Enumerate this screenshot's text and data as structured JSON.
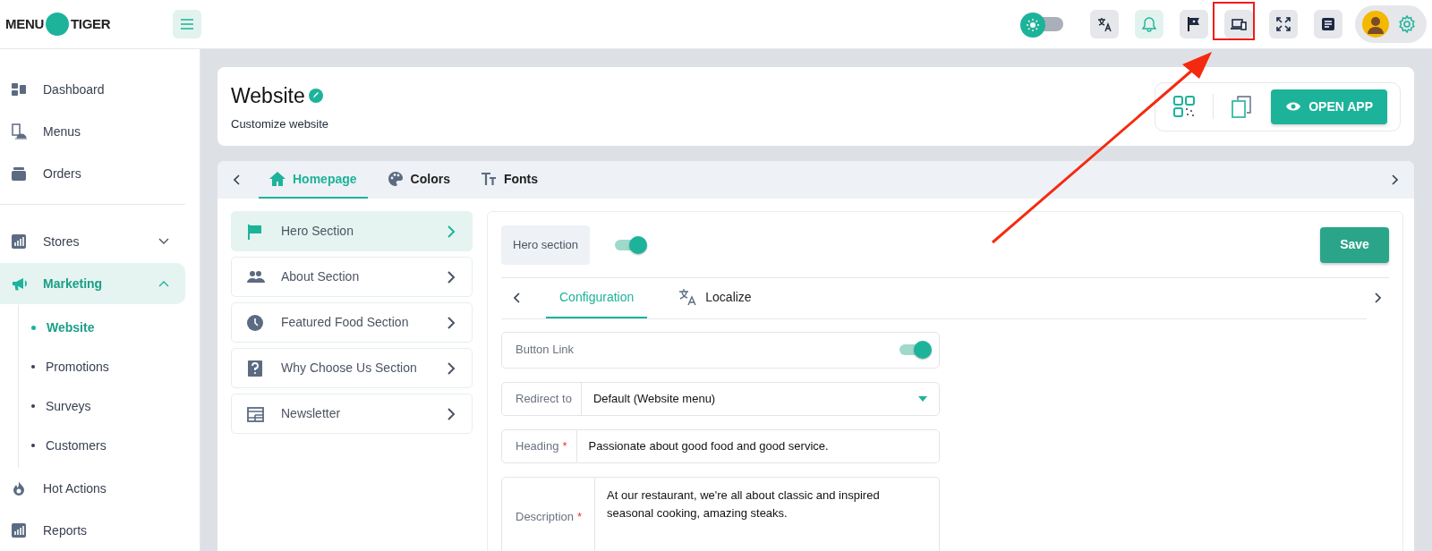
{
  "logo": {
    "left": "MENU",
    "right": "TIGER"
  },
  "topbar": {
    "dark_mode": false
  },
  "sidebar": {
    "groups": [
      {
        "items": [
          {
            "label": "Dashboard"
          },
          {
            "label": "Menus"
          },
          {
            "label": "Orders"
          }
        ]
      },
      {
        "items": [
          {
            "label": "Stores",
            "selected": false,
            "expanded": false
          },
          {
            "label": "Marketing",
            "selected": true,
            "expanded": true,
            "children": [
              {
                "label": "Website",
                "selected": true
              },
              {
                "label": "Promotions",
                "selected": false
              },
              {
                "label": "Surveys",
                "selected": false
              },
              {
                "label": "Customers",
                "selected": false
              }
            ]
          },
          {
            "label": "Hot Actions",
            "selected": false
          },
          {
            "label": "Reports",
            "selected": false
          }
        ]
      }
    ]
  },
  "page_header": {
    "title": "Website",
    "subtitle": "Customize website",
    "open_app_button": "OPEN APP"
  },
  "tabs": [
    {
      "label": "Homepage",
      "selected": true
    },
    {
      "label": "Colors",
      "selected": false
    },
    {
      "label": "Fonts",
      "selected": false
    }
  ],
  "sections": [
    {
      "label": "Hero Section",
      "selected": true
    },
    {
      "label": "About Section",
      "selected": false
    },
    {
      "label": "Featured Food Section",
      "selected": false
    },
    {
      "label": "Why Choose Us Section",
      "selected": false
    },
    {
      "label": "Newsletter",
      "selected": false
    }
  ],
  "hero": {
    "label": "Hero section",
    "on": true,
    "save_button": "Save"
  },
  "subtabs": [
    {
      "label": "Configuration",
      "selected": true
    },
    {
      "label": "Localize",
      "selected": false
    }
  ],
  "form": {
    "button_link": {
      "label": "Button Link",
      "on": true
    },
    "redirect": {
      "label": "Redirect to",
      "value": "Default (Website menu)"
    },
    "heading": {
      "label": "Heading",
      "required_mark": "*",
      "value": "Passionate about good food and good service."
    },
    "description": {
      "label": "Description",
      "required_mark": "*",
      "value": "At our restaurant, we're all about classic and inspired seasonal cooking, amazing steaks."
    }
  }
}
